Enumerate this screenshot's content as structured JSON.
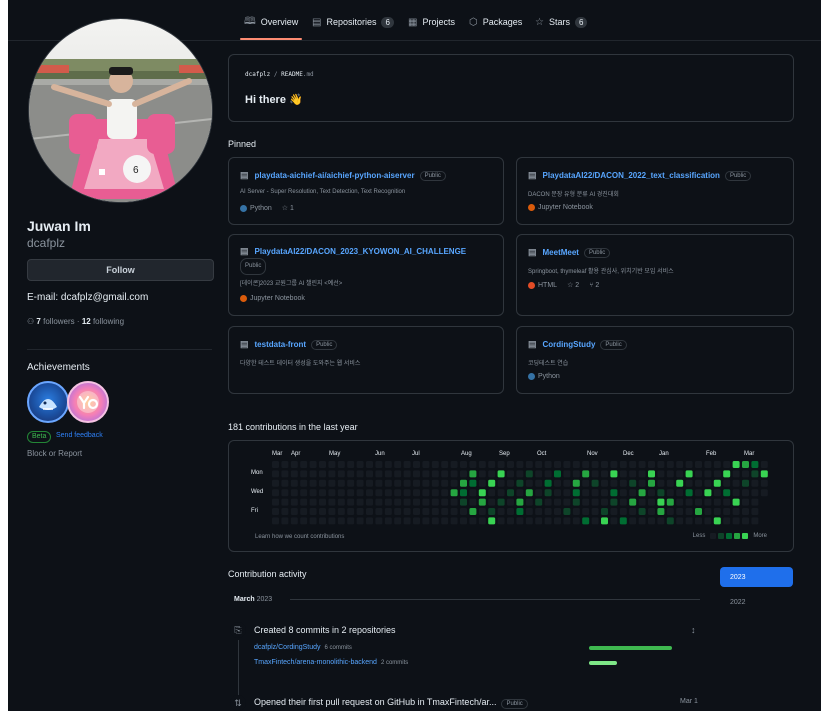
{
  "tabs": [
    {
      "label": "Overview",
      "icon": "book-icon",
      "active": true
    },
    {
      "label": "Repositories",
      "icon": "repo-icon",
      "count": "6"
    },
    {
      "label": "Projects",
      "icon": "table-icon"
    },
    {
      "label": "Packages",
      "icon": "package-icon"
    },
    {
      "label": "Stars",
      "icon": "star-icon",
      "count": "6"
    }
  ],
  "profile": {
    "name": "Juwan Im",
    "login": "dcafplz",
    "follow_label": "Follow",
    "email": "E-mail: dcafplz@gmail.com",
    "followers_count": "7",
    "followers_label": "followers",
    "dot": "·",
    "following_count": "12",
    "following_label": "following",
    "achievements_title": "Achievements",
    "beta_label": "Beta",
    "feedback_label": "Send feedback",
    "block_label": "Block or Report"
  },
  "readme": {
    "user": "dcafplz",
    "sep": " / ",
    "file": "README",
    "ext": ".md",
    "greeting": "Hi there 👋"
  },
  "pinned": {
    "title": "Pinned",
    "public_label": "Public",
    "cards": [
      {
        "name": "playdata-aichief-ai/aichief-python-aiserver",
        "desc": "AI Server - Super Resolution, Text Detection, Text Recognition",
        "lang": "Python",
        "lang_color": "#3572A5",
        "stars": "1",
        "forks": ""
      },
      {
        "name": "PlaydataAI22/DACON_2022_text_classification",
        "desc": "DACON 문장 유형 분류 AI 경진대회",
        "lang": "Jupyter Notebook",
        "lang_color": "#DA5B0B",
        "stars": "",
        "forks": ""
      },
      {
        "name": "PlaydataAI22/DACON_2023_KYOWON_AI_CHALLENGE",
        "desc": "[데이콘]2023 교원그룹 AI 챌린지 <예선>",
        "lang": "Jupyter Notebook",
        "lang_color": "#DA5B0B",
        "stars": "",
        "forks": ""
      },
      {
        "name": "MeetMeet",
        "desc": "Springboot, thymeleaf 활용 관심사, 위치기반 모임 서비스",
        "lang": "HTML",
        "lang_color": "#e34c26",
        "stars": "2",
        "forks": "2"
      },
      {
        "name": "testdata-front",
        "desc": "다양한 테스트 데이터 생성을 도와주는 웹 서비스",
        "lang": "",
        "lang_color": "",
        "stars": "",
        "forks": ""
      },
      {
        "name": "CordingStudy",
        "desc": "코딩테스트 연습",
        "lang": "Python",
        "lang_color": "#3572A5",
        "stars": "",
        "forks": ""
      }
    ]
  },
  "contributions": {
    "title": "181 contributions in the last year",
    "months": [
      "Mar",
      "Apr",
      "May",
      "Jun",
      "Jul",
      "Aug",
      "Sep",
      "Oct",
      "Nov",
      "Dec",
      "Jan",
      "Feb",
      "Mar"
    ],
    "days": [
      "Mon",
      "Wed",
      "Fri"
    ],
    "learn_label": "Learn how we count contributions",
    "less_label": "Less",
    "more_label": "More",
    "colors": [
      "#161b22",
      "#0e4429",
      "#006d32",
      "#26a641",
      "#39d353"
    ]
  },
  "activity": {
    "title": "Contribution activity",
    "years": [
      "2023",
      "2022"
    ],
    "month_label": "March",
    "month_year": "2023",
    "created_text": "Created 8 commits in 2 repositories",
    "repos": [
      {
        "name": "dcafplz/CordingStudy",
        "commits": "6 commits",
        "fraction": 0.75
      },
      {
        "name": "TmaxFintech/arena-monolithic-backend",
        "commits": "2 commits",
        "fraction": 0.25
      }
    ],
    "pr_text": "Opened their first pull request on GitHub in TmaxFintech/ar...",
    "pr_public": "Public",
    "pr_date": "Mar 1"
  }
}
